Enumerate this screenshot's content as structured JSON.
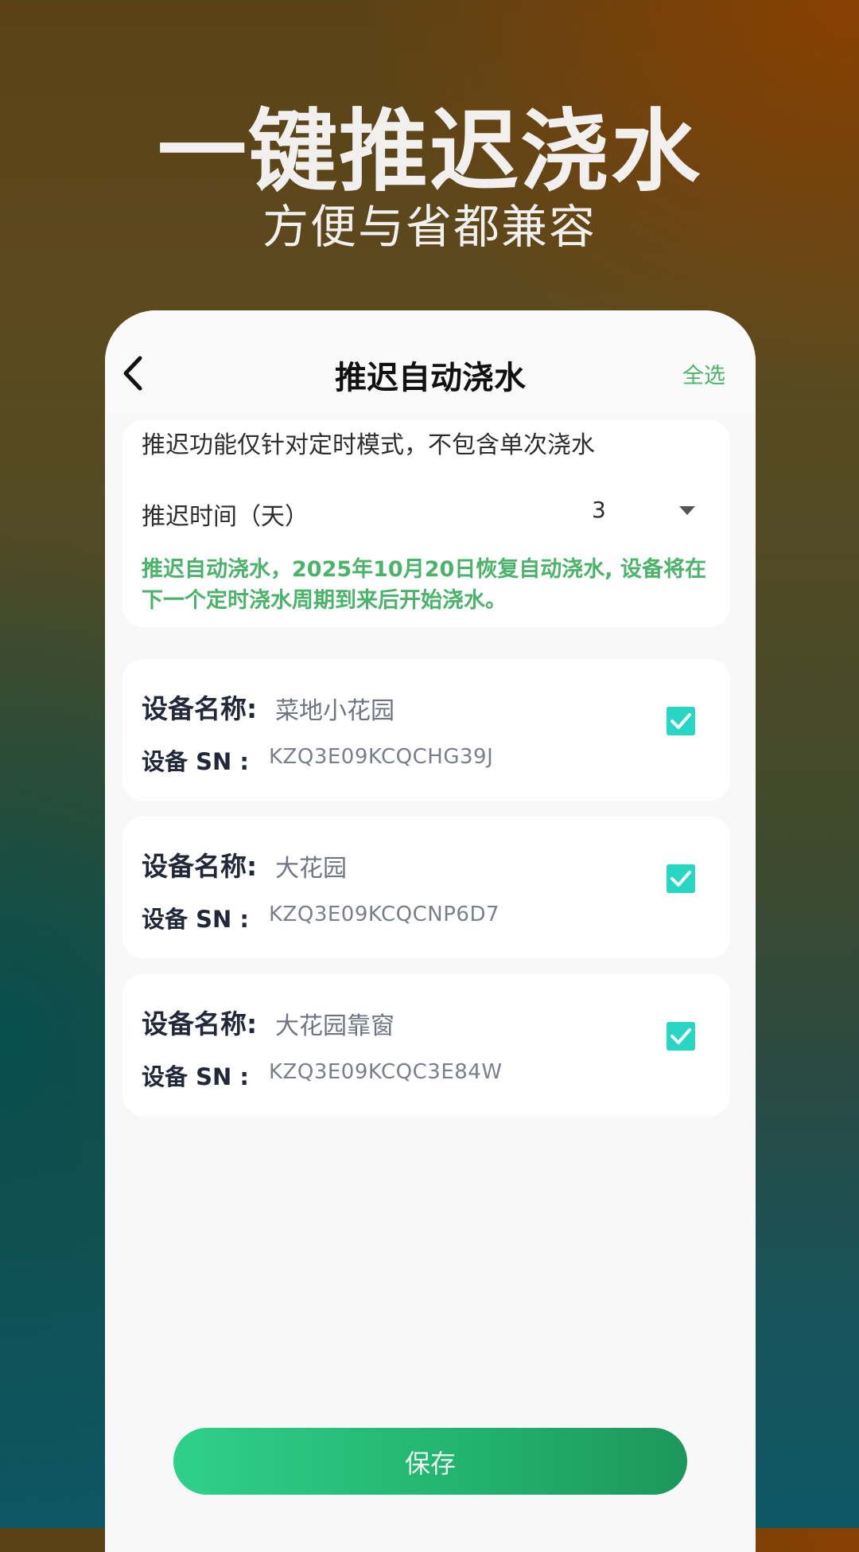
{
  "hero": {
    "title": "一键推迟浇水",
    "subtitle": "方便与省都兼容"
  },
  "nav": {
    "back_icon": "chevron-left-icon",
    "title": "推迟自动浇水",
    "select_all": "全选"
  },
  "settings": {
    "notice": "推迟功能仅针对定时模式，不包含单次浇水",
    "delay_label": "推迟时间（天）",
    "delay_value": "3",
    "dropdown_icon": "caret-down-icon",
    "hint": "推迟自动浇水，2025年10月20日恢复自动浇水, 设备将在下一个定时浇水周期到来后开始浇水。"
  },
  "devices": [
    {
      "name_label": "设备名称:",
      "name": "菜地小花园",
      "sn_label": "设备 SN :",
      "sn": "KZQ3E09KCQCHG39J",
      "checked": true
    },
    {
      "name_label": "设备名称:",
      "name": "大花园",
      "sn_label": "设备 SN :",
      "sn": "KZQ3E09KCQCNP6D7",
      "checked": true
    },
    {
      "name_label": "设备名称:",
      "name": "大花园靠窗",
      "sn_label": "设备 SN :",
      "sn": "KZQ3E09KCQC3E84W",
      "checked": true
    }
  ],
  "footer": {
    "save_label": "保存"
  },
  "colors": {
    "accent_green": "#4cb36a",
    "checkbox": "#27d7c4",
    "save_gradient_start": "#2fd08a",
    "save_gradient_end": "#1d975c"
  }
}
